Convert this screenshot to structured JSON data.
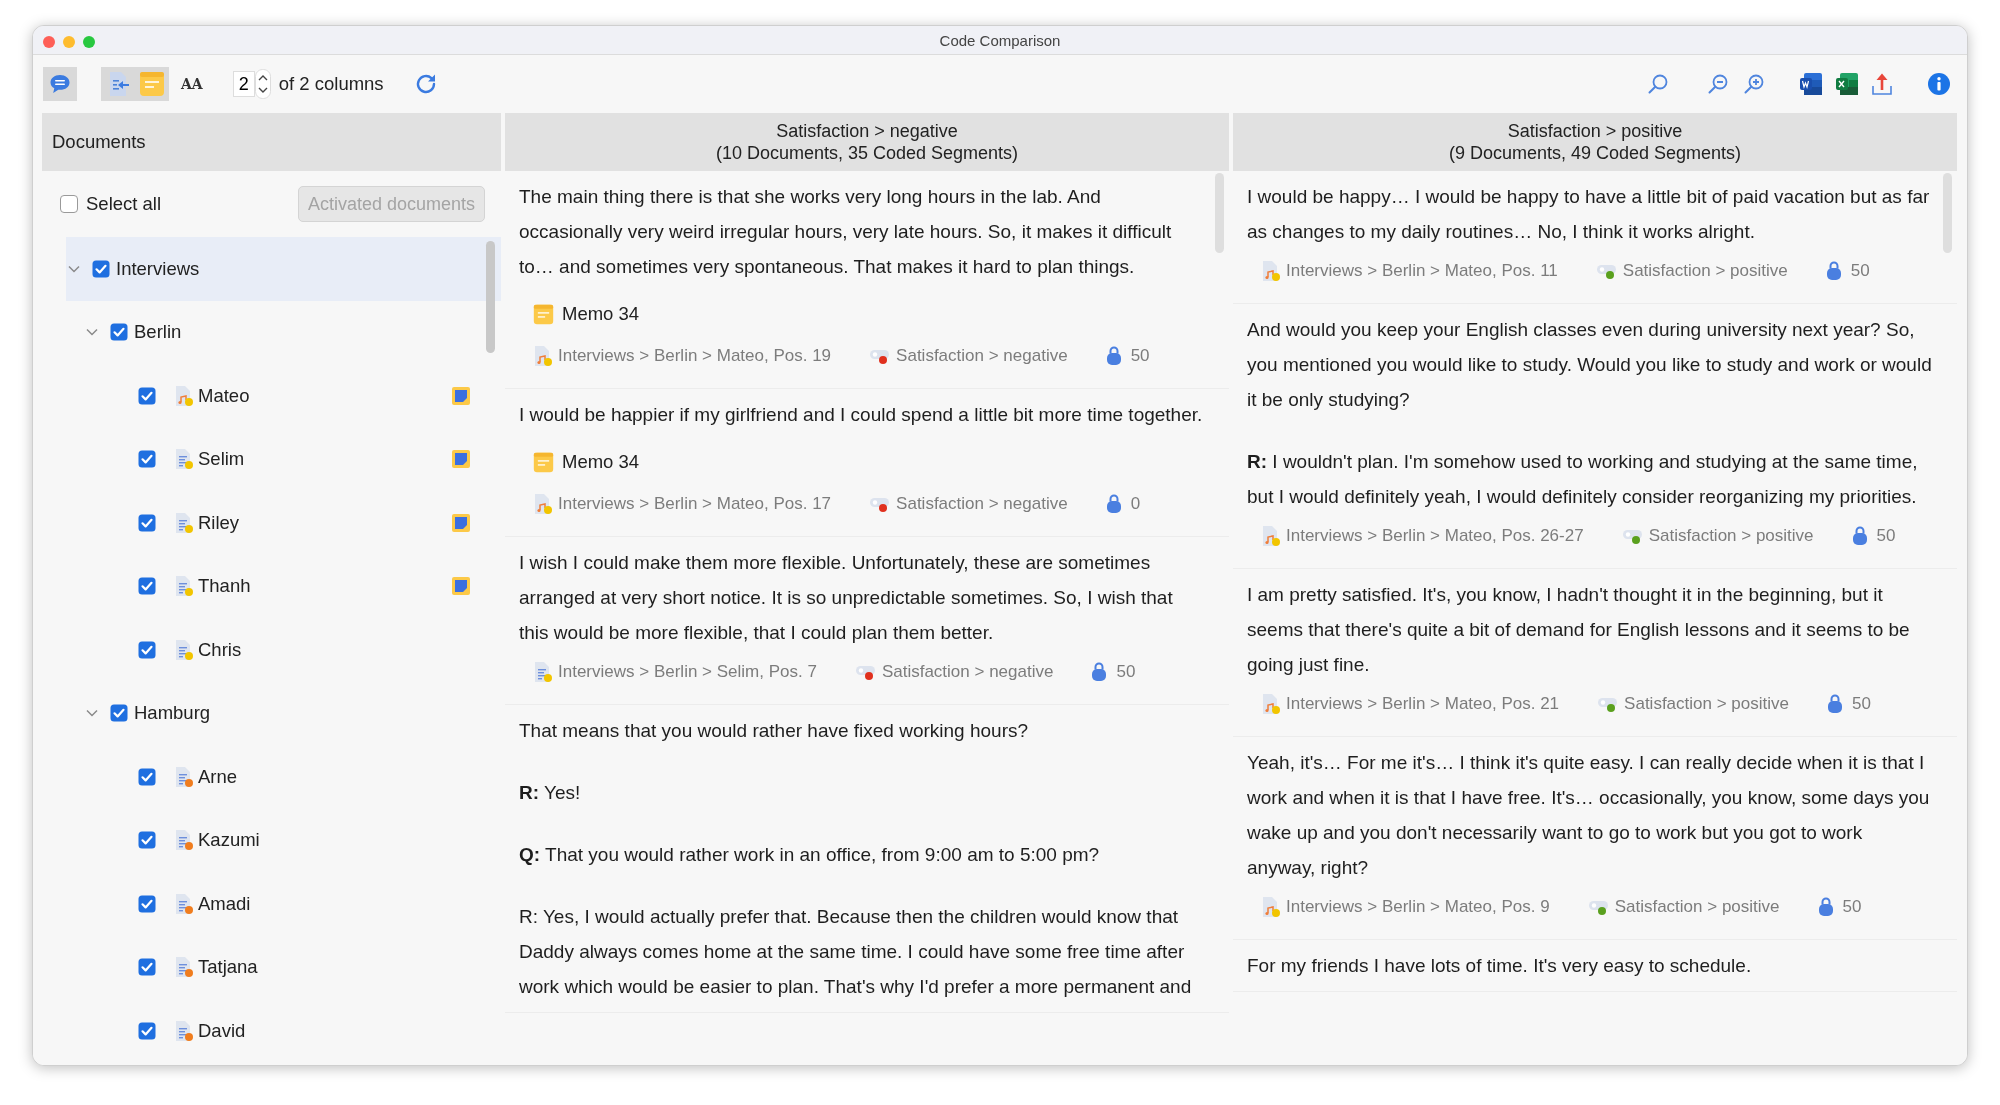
{
  "window": {
    "title": "Code Comparison"
  },
  "toolbar": {
    "toggles": [
      {
        "kind": "comments",
        "pressed": true
      },
      {
        "kind": "import",
        "pressed": true
      },
      {
        "kind": "memo",
        "pressed": true
      }
    ],
    "font_size_button": "AA",
    "column_count": {
      "value": "2",
      "label": "of 2 columns"
    },
    "refresh": {
      "kind": "refresh"
    },
    "right_buttons": [
      {
        "kind": "search"
      },
      {
        "kind": "zoom-out"
      },
      {
        "kind": "zoom-in"
      },
      {
        "kind": "word"
      },
      {
        "kind": "excel"
      },
      {
        "kind": "export"
      },
      {
        "kind": "info"
      }
    ]
  },
  "sidebar": {
    "title": "Documents",
    "select_all": {
      "label": "Select all",
      "checked": false
    },
    "activated_button": {
      "label": "Activated documents",
      "disabled": true
    },
    "tree": [
      {
        "label": "Interviews",
        "checked": true,
        "selected": true,
        "expanded": true,
        "children": [
          {
            "label": "Berlin",
            "checked": true,
            "selected": false,
            "expanded": true,
            "children": [
              {
                "label": "Mateo",
                "checked": true,
                "selected": false,
                "kind": "audio",
                "color": "#f2c500",
                "memo": true
              },
              {
                "label": "Selim",
                "checked": true,
                "selected": false,
                "kind": "text",
                "color": "#f2c500",
                "memo": true
              },
              {
                "label": "Riley",
                "checked": true,
                "selected": false,
                "kind": "text",
                "color": "#f2c500",
                "memo": true
              },
              {
                "label": "Thanh",
                "checked": true,
                "selected": false,
                "kind": "text",
                "color": "#f2c500",
                "memo": true
              },
              {
                "label": "Chris",
                "checked": true,
                "selected": false,
                "kind": "text",
                "color": "#f2c500",
                "memo": false
              }
            ]
          },
          {
            "label": "Hamburg",
            "checked": true,
            "selected": false,
            "expanded": true,
            "children": [
              {
                "label": "Arne",
                "checked": true,
                "selected": false,
                "kind": "text",
                "color": "#f07d1e",
                "memo": false
              },
              {
                "label": "Kazumi",
                "checked": true,
                "selected": false,
                "kind": "text",
                "color": "#f07d1e",
                "memo": false
              },
              {
                "label": "Amadi",
                "checked": true,
                "selected": false,
                "kind": "text",
                "color": "#f07d1e",
                "memo": false
              },
              {
                "label": "Tatjana",
                "checked": true,
                "selected": false,
                "kind": "text",
                "color": "#f07d1e",
                "memo": false
              },
              {
                "label": "David",
                "checked": true,
                "selected": false,
                "kind": "text",
                "color": "#f07d1e",
                "memo": false
              }
            ]
          }
        ]
      }
    ]
  },
  "columns": [
    {
      "title": "Satisfaction > negative",
      "subtitle": "(10 Documents, 35 Coded Segments)",
      "segments": [
        {
          "paragraphs": [
            "The main thing there is that she works very long hours in the lab. And occasionally very weird irregular hours, very late hours. So, it makes it difficult to… and sometimes very spontaneous. That makes it hard to plan things."
          ],
          "memo": "Memo 34",
          "source": {
            "text": "Interviews > Berlin > Mateo, Pos. 19",
            "kind": "audio",
            "color": "#f2c500"
          },
          "code": {
            "text": "Satisfaction > negative",
            "color": "#e0301e"
          },
          "weight": "50"
        },
        {
          "paragraphs": [
            "I would be happier if my girlfriend and I could spend a little bit more time together."
          ],
          "memo": "Memo 34",
          "source": {
            "text": "Interviews > Berlin > Mateo, Pos. 17",
            "kind": "audio",
            "color": "#f2c500"
          },
          "code": {
            "text": "Satisfaction > negative",
            "color": "#e0301e"
          },
          "weight": "0"
        },
        {
          "paragraphs": [
            "I wish I could make them more flexible. Unfortunately, these are sometimes arranged at very short notice. It is so unpredictable sometimes. So, I wish that this would be more flexible, that I could plan them better."
          ],
          "source": {
            "text": "Interviews > Berlin > Selim, Pos. 7",
            "kind": "text",
            "color": "#f2c500"
          },
          "code": {
            "text": "Satisfaction > negative",
            "color": "#e0301e"
          },
          "weight": "50"
        },
        {
          "paragraphs": [
            "That means that you would rather have fixed working hours?",
            "**R:** Yes!",
            "**Q:** That you would rather work in an office, from 9:00 am to 5:00 pm?",
            "R: Yes, I would actually prefer that. Because then the children would know that Daddy always comes home at the same time. I could have some free time after work which would be easier to plan. That's why I'd prefer a more permanent and"
          ]
        }
      ]
    },
    {
      "title": "Satisfaction > positive",
      "subtitle": "(9 Documents, 49 Coded Segments)",
      "segments": [
        {
          "paragraphs": [
            "I would be happy… I would be happy to have a little bit of paid vacation but as far as changes to my daily routines… No, I think it works alright."
          ],
          "source": {
            "text": "Interviews > Berlin > Mateo, Pos. 11",
            "kind": "audio",
            "color": "#f2c500"
          },
          "code": {
            "text": "Satisfaction > positive",
            "color": "#5aa01e"
          },
          "weight": "50"
        },
        {
          "paragraphs": [
            "And would you keep your English classes even during university next year? So, you mentioned you would like to study. Would you like to study and work or would it be only studying?",
            "**R:** I wouldn't plan. I'm somehow used to working and studying at the same time, but I would definitely yeah, I would definitely consider reorganizing my priorities."
          ],
          "source": {
            "text": "Interviews > Berlin > Mateo, Pos. 26-27",
            "kind": "audio",
            "color": "#f2c500"
          },
          "code": {
            "text": "Satisfaction > positive",
            "color": "#5aa01e"
          },
          "weight": "50"
        },
        {
          "paragraphs": [
            "I am pretty satisfied. It's, you know, I hadn't thought it in the beginning, but it seems that there's quite a bit of demand for English lessons and it seems to be going just fine."
          ],
          "source": {
            "text": "Interviews > Berlin > Mateo, Pos. 21",
            "kind": "audio",
            "color": "#f2c500"
          },
          "code": {
            "text": "Satisfaction > positive",
            "color": "#5aa01e"
          },
          "weight": "50"
        },
        {
          "paragraphs": [
            "Yeah, it's… For me it's… I think it's quite easy. I can really decide when it is that I work and when it is that I have free. It's… occasionally, you know, some days you wake up and you don't necessarily want to go to work but you got to work anyway, right?"
          ],
          "source": {
            "text": "Interviews > Berlin > Mateo, Pos. 9",
            "kind": "audio",
            "color": "#f2c500"
          },
          "code": {
            "text": "Satisfaction > positive",
            "color": "#5aa01e"
          },
          "weight": "50"
        },
        {
          "paragraphs": [
            "For my friends I have lots of time. It's very easy to schedule."
          ]
        }
      ]
    }
  ]
}
